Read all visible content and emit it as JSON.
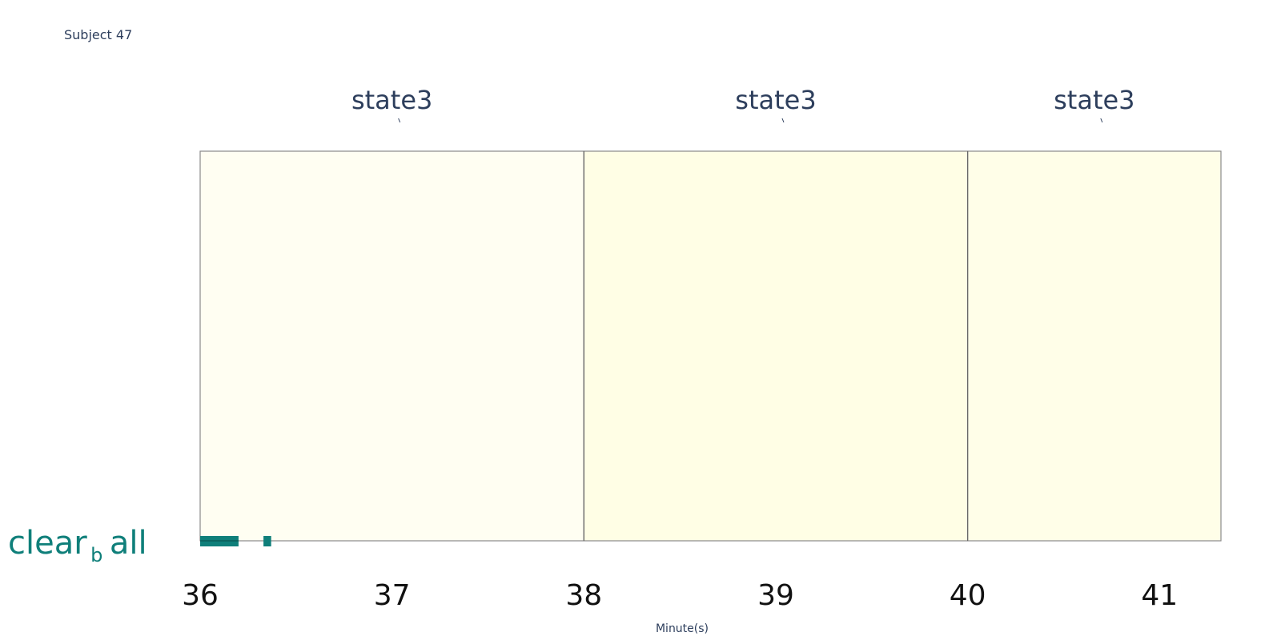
{
  "subject": {
    "label": "Subject 47"
  },
  "chart_data": {
    "type": "timeline",
    "title": "",
    "xlabel": "Minute(s)",
    "ylabel": "",
    "xlim": [
      36,
      41.32
    ],
    "ticks": [
      36,
      37,
      38,
      39,
      40,
      41
    ],
    "tick_labels": [
      "36",
      "37",
      "38",
      "39",
      "40",
      "41"
    ],
    "segments": [
      {
        "label": "state3",
        "start": 36.0,
        "end": 38.0,
        "color": "#fffef2"
      },
      {
        "label": "state3",
        "start": 38.0,
        "end": 40.0,
        "color": "#fffee5"
      },
      {
        "label": "state3",
        "start": 40.0,
        "end": 41.32,
        "color": "#fffee8"
      }
    ],
    "event_track": {
      "label_main": "clear",
      "label_sub": "b",
      "label_end": "all",
      "color": "#0f7f7a",
      "intervals": [
        [
          36.0,
          36.2
        ],
        [
          36.33,
          36.37
        ]
      ]
    }
  }
}
